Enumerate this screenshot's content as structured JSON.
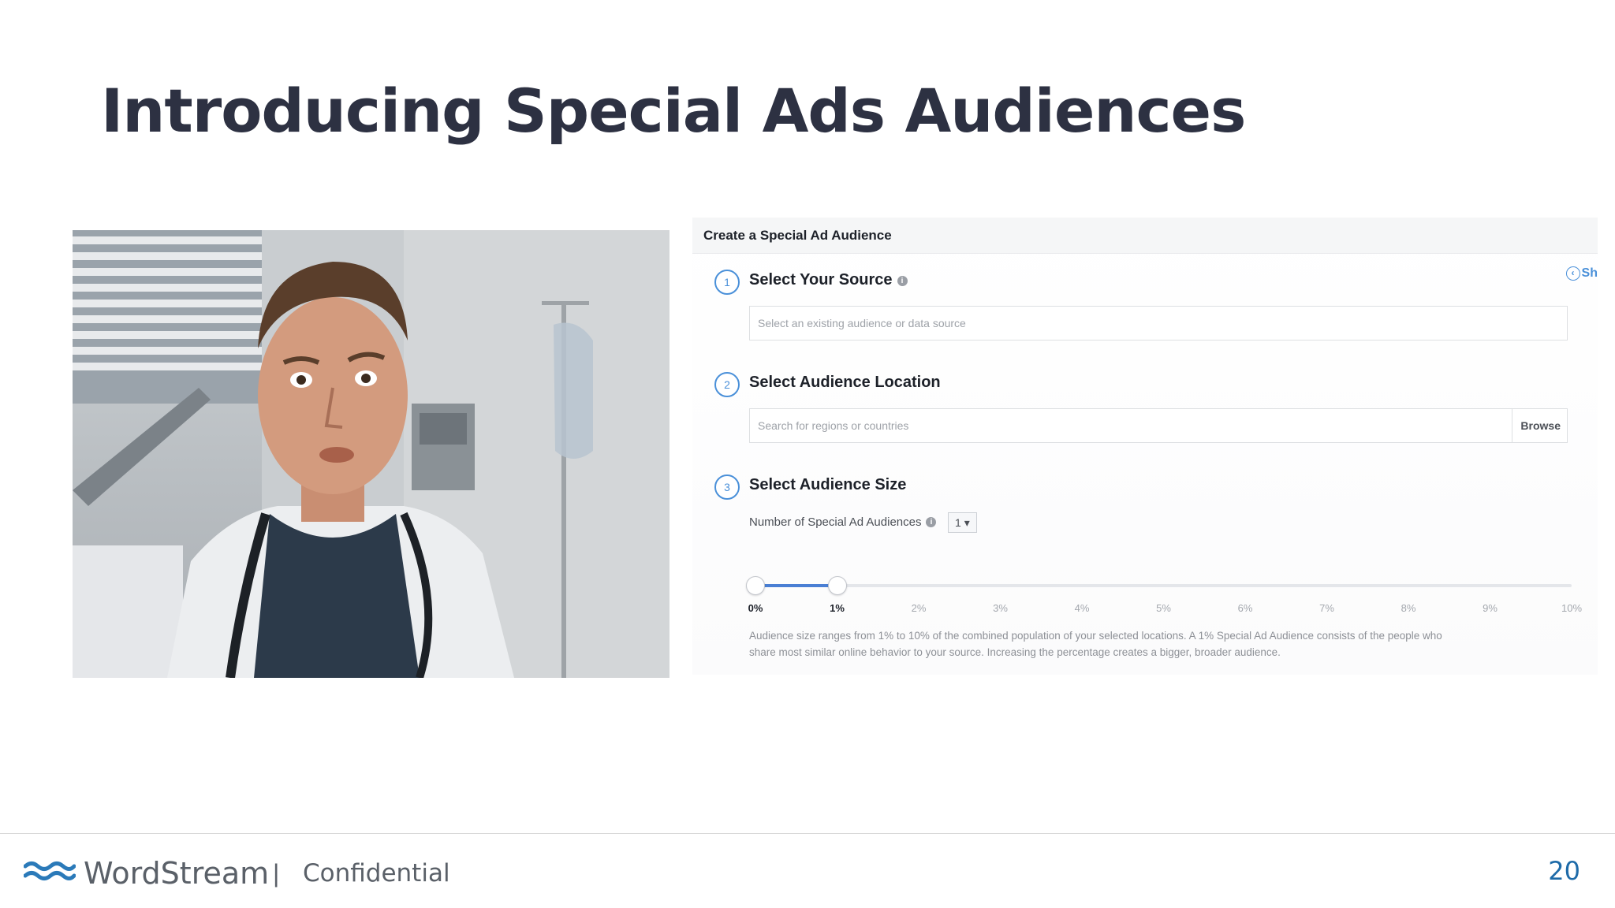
{
  "slide": {
    "title": "Introducing Special Ads Audiences",
    "page_number": "20"
  },
  "footer": {
    "brand": "WordStream",
    "separator": "|",
    "label": "Confidential",
    "logo_icon": "wave-logo-icon"
  },
  "panel": {
    "header": "Create a Special Ad Audience",
    "show_link": "Sh",
    "steps": [
      {
        "number": "1",
        "title": "Select Your Source",
        "placeholder": "Select an existing audience or data source"
      },
      {
        "number": "2",
        "title": "Select Audience Location",
        "placeholder": "Search for regions or countries",
        "browse_label": "Browse"
      },
      {
        "number": "3",
        "title": "Select Audience Size"
      }
    ],
    "audience_count_label": "Number of Special Ad Audiences",
    "audience_count_value": "1",
    "slider": {
      "ticks": [
        "0%",
        "1%",
        "2%",
        "3%",
        "4%",
        "5%",
        "6%",
        "7%",
        "8%",
        "9%",
        "10%"
      ],
      "selected_min": "0%",
      "selected_max": "1%"
    },
    "description_line1": "Audience size ranges from 1% to 10% of the combined population of your selected locations. A 1% Special Ad Audience consists of the people who",
    "description_line2": "share most similar online behavior to your source. Increasing the percentage creates a bigger, broader audience."
  },
  "colors": {
    "title": "#2d3142",
    "accent": "#4a90d9",
    "page_number": "#1d6aa8"
  }
}
